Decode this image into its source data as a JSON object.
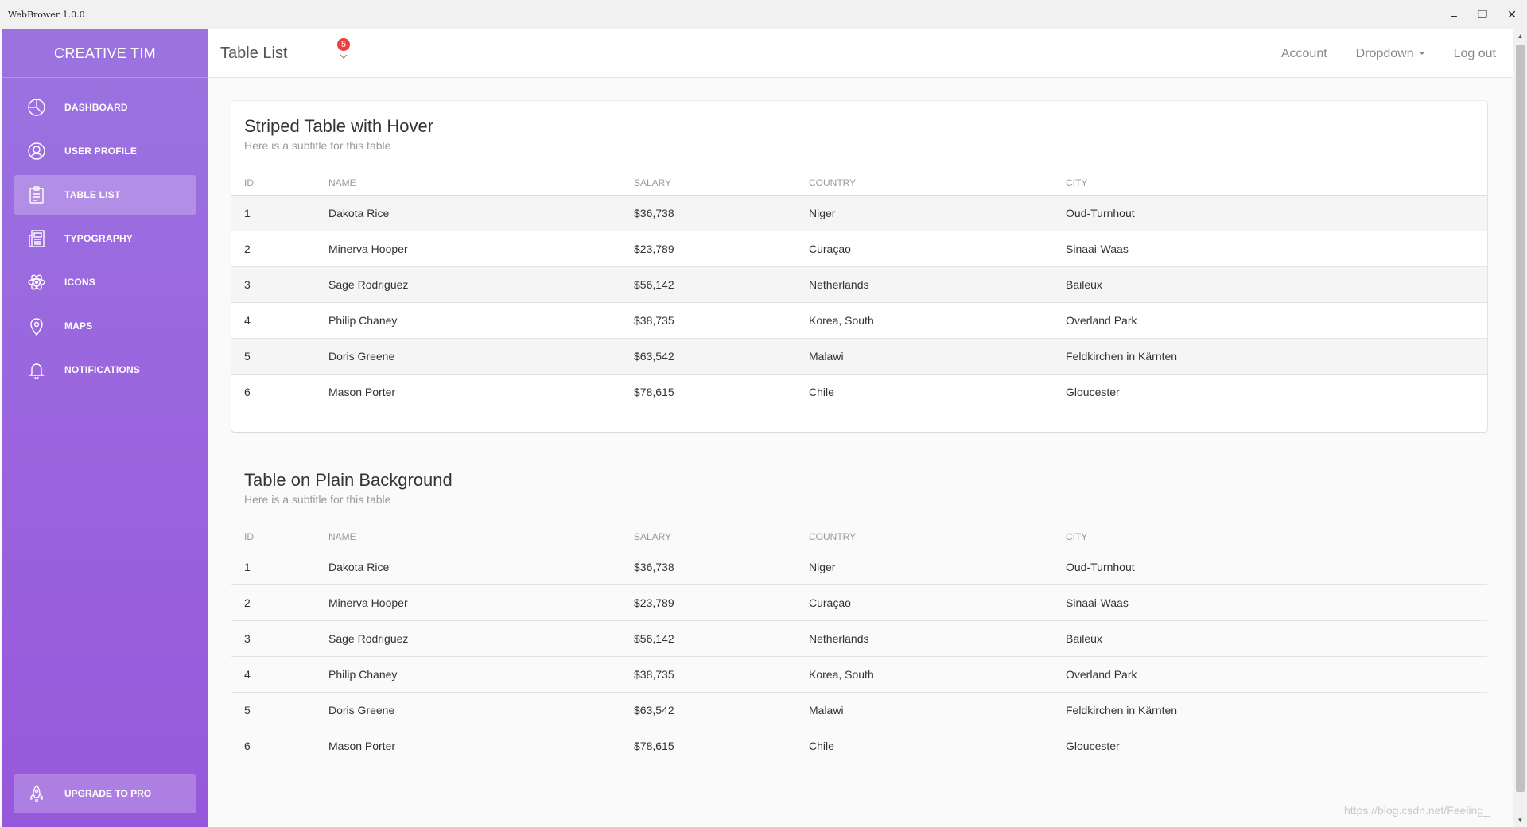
{
  "window": {
    "title": "WebBrower 1.0.0",
    "min": "–",
    "max": "❐",
    "close": "✕"
  },
  "sidebar": {
    "brand": "CREATIVE TIM",
    "items": [
      {
        "label": "DASHBOARD",
        "icon": "chart-pie-icon"
      },
      {
        "label": "USER PROFILE",
        "icon": "user-icon"
      },
      {
        "label": "TABLE LIST",
        "icon": "clipboard-icon",
        "active": true
      },
      {
        "label": "TYPOGRAPHY",
        "icon": "news-paper-icon"
      },
      {
        "label": "ICONS",
        "icon": "atom-icon"
      },
      {
        "label": "MAPS",
        "icon": "map-pin-icon"
      },
      {
        "label": "NOTIFICATIONS",
        "icon": "bell-icon"
      }
    ],
    "upgrade": {
      "label": "UPGRADE TO PRO",
      "icon": "rocket-icon"
    }
  },
  "header": {
    "title": "Table List",
    "notification_count": "5",
    "links": {
      "account": "Account",
      "dropdown": "Dropdown",
      "logout": "Log out"
    }
  },
  "tables": [
    {
      "title": "Striped Table with Hover",
      "subtitle": "Here is a subtitle for this table",
      "columns": [
        "ID",
        "NAME",
        "SALARY",
        "COUNTRY",
        "CITY"
      ],
      "rows": [
        [
          "1",
          "Dakota Rice",
          "$36,738",
          "Niger",
          "Oud-Turnhout"
        ],
        [
          "2",
          "Minerva Hooper",
          "$23,789",
          "Curaçao",
          "Sinaai-Waas"
        ],
        [
          "3",
          "Sage Rodriguez",
          "$56,142",
          "Netherlands",
          "Baileux"
        ],
        [
          "4",
          "Philip Chaney",
          "$38,735",
          "Korea, South",
          "Overland Park"
        ],
        [
          "5",
          "Doris Greene",
          "$63,542",
          "Malawi",
          "Feldkirchen in Kärnten"
        ],
        [
          "6",
          "Mason Porter",
          "$78,615",
          "Chile",
          "Gloucester"
        ]
      ]
    },
    {
      "title": "Table on Plain Background",
      "subtitle": "Here is a subtitle for this table",
      "columns": [
        "ID",
        "NAME",
        "SALARY",
        "COUNTRY",
        "CITY"
      ],
      "rows": [
        [
          "1",
          "Dakota Rice",
          "$36,738",
          "Niger",
          "Oud-Turnhout"
        ],
        [
          "2",
          "Minerva Hooper",
          "$23,789",
          "Curaçao",
          "Sinaai-Waas"
        ],
        [
          "3",
          "Sage Rodriguez",
          "$56,142",
          "Netherlands",
          "Baileux"
        ],
        [
          "4",
          "Philip Chaney",
          "$38,735",
          "Korea, South",
          "Overland Park"
        ],
        [
          "5",
          "Doris Greene",
          "$63,542",
          "Malawi",
          "Feldkirchen in Kärnten"
        ],
        [
          "6",
          "Mason Porter",
          "$78,615",
          "Chile",
          "Gloucester"
        ]
      ]
    }
  ],
  "watermark": "https://blog.csdn.net/Feeling_",
  "colors": {
    "sidebar_top": "#9b73e0",
    "sidebar_bottom": "#9658da",
    "badge": "#ee3f3f"
  }
}
